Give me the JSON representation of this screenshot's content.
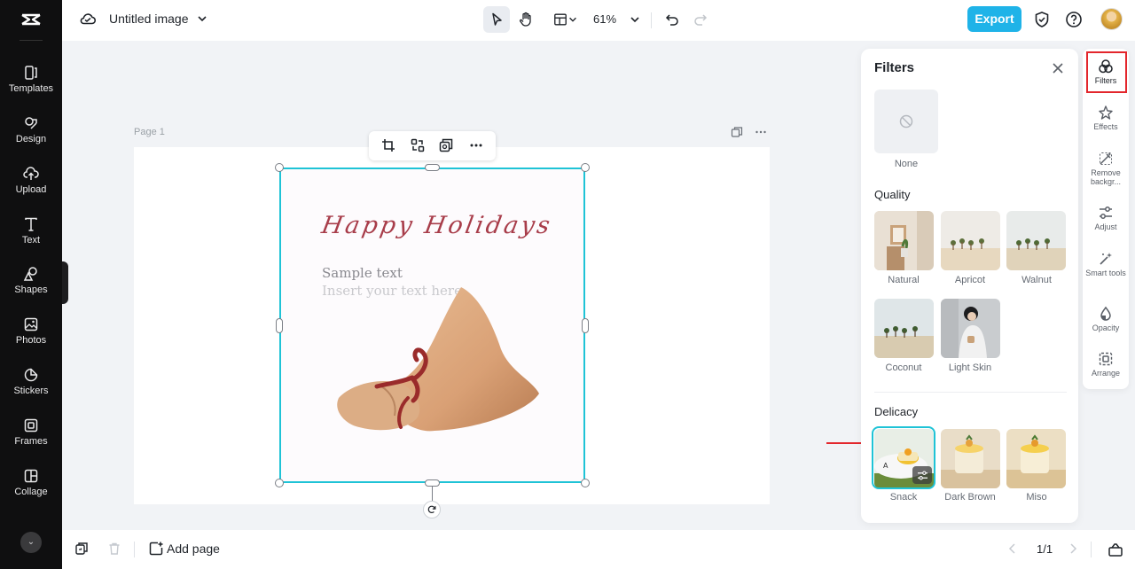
{
  "app": {
    "document_title": "Untitled image",
    "zoom": "61%",
    "export_label": "Export"
  },
  "left_nav": [
    {
      "label": "Templates",
      "icon": "templates-icon"
    },
    {
      "label": "Design",
      "icon": "design-icon"
    },
    {
      "label": "Upload",
      "icon": "upload-icon"
    },
    {
      "label": "Text",
      "icon": "text-icon"
    },
    {
      "label": "Shapes",
      "icon": "shapes-icon"
    },
    {
      "label": "Photos",
      "icon": "photos-icon"
    },
    {
      "label": "Stickers",
      "icon": "stickers-icon"
    },
    {
      "label": "Frames",
      "icon": "frames-icon"
    },
    {
      "label": "Collage",
      "icon": "collage-icon"
    }
  ],
  "canvas": {
    "page_label": "Page 1",
    "greeting": "Happy Holidays",
    "sample_text": "Sample text",
    "insert_text": "Insert your text here"
  },
  "filters_panel": {
    "title": "Filters",
    "none_label": "None",
    "quality_title": "Quality",
    "quality": [
      "Natural",
      "Apricot",
      "Walnut",
      "Coconut",
      "Light Skin"
    ],
    "delicacy_title": "Delicacy",
    "delicacy": [
      "Snack",
      "Dark Brown",
      "Miso"
    ],
    "selected": "Snack"
  },
  "right_tools": [
    {
      "label": "Filters",
      "icon": "filters-icon",
      "active": true
    },
    {
      "label": "Effects",
      "icon": "effects-icon"
    },
    {
      "label": "Remove backgr...",
      "icon": "remove-background-icon"
    },
    {
      "label": "Adjust",
      "icon": "adjust-icon"
    },
    {
      "label": "Smart tools",
      "icon": "smart-tools-icon"
    },
    {
      "label": "Opacity",
      "icon": "opacity-icon"
    },
    {
      "label": "Arrange",
      "icon": "arrange-icon"
    }
  ],
  "bottom": {
    "add_page_label": "Add page",
    "pager": "1/1"
  },
  "colors": {
    "accent": "#1fc3d6",
    "export": "#1fb3e8",
    "highlight": "#e3262c",
    "greeting": "#a83d4a"
  }
}
